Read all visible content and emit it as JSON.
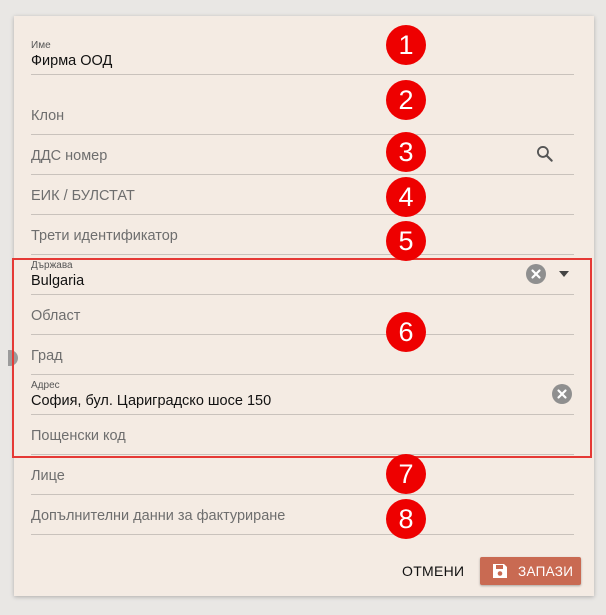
{
  "form": {
    "name": {
      "label": "Име",
      "value": "Фирма ООД"
    },
    "branch": {
      "placeholder": "Клон"
    },
    "vat": {
      "placeholder": "ДДС номер"
    },
    "eik": {
      "placeholder": "ЕИК / БУЛСТАТ"
    },
    "third_id": {
      "placeholder": "Трети идентификатор"
    },
    "country": {
      "label": "Държава",
      "value": "Bulgaria"
    },
    "region": {
      "placeholder": "Област"
    },
    "city": {
      "placeholder": "Град"
    },
    "address": {
      "label": "Адрес",
      "value": "София, бул. Цариградско шосе 150"
    },
    "postal": {
      "placeholder": "Пощенски код"
    },
    "person": {
      "placeholder": "Лице"
    },
    "billing": {
      "placeholder": "Допълнителни данни за фактуриране"
    }
  },
  "badges": [
    "1",
    "2",
    "3",
    "4",
    "5",
    "6",
    "7",
    "8"
  ],
  "actions": {
    "cancel": "ОТМЕНИ",
    "save": "ЗАПАЗИ"
  },
  "icons": {
    "vat_search": "search-icon",
    "country_clear": "clear-icon",
    "country_dropdown": "dropdown-arrow-icon",
    "address_clear": "clear-icon",
    "save": "floppy-disk-icon"
  },
  "colors": {
    "badge": "#ee0000",
    "highlight": "#e53935",
    "save_button": "#c96a52",
    "dialog_bg": "#f4ebe3"
  }
}
